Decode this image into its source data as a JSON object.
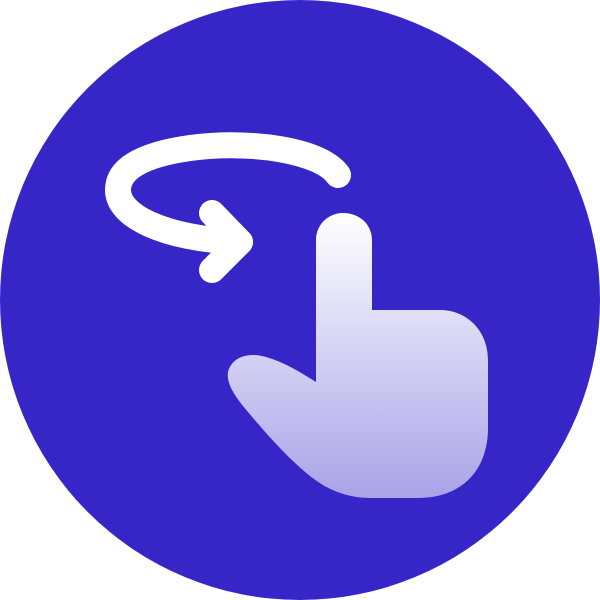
{
  "icon": {
    "name": "rotate-gesture-icon",
    "background_color": "#3626C7",
    "foreground_color": "#FFFFFF",
    "hand_gradient": [
      "#FFFFFF",
      "#A9A3E8"
    ],
    "parts": [
      "circle-background",
      "rotate-arrow-icon",
      "pointing-hand-icon"
    ]
  }
}
